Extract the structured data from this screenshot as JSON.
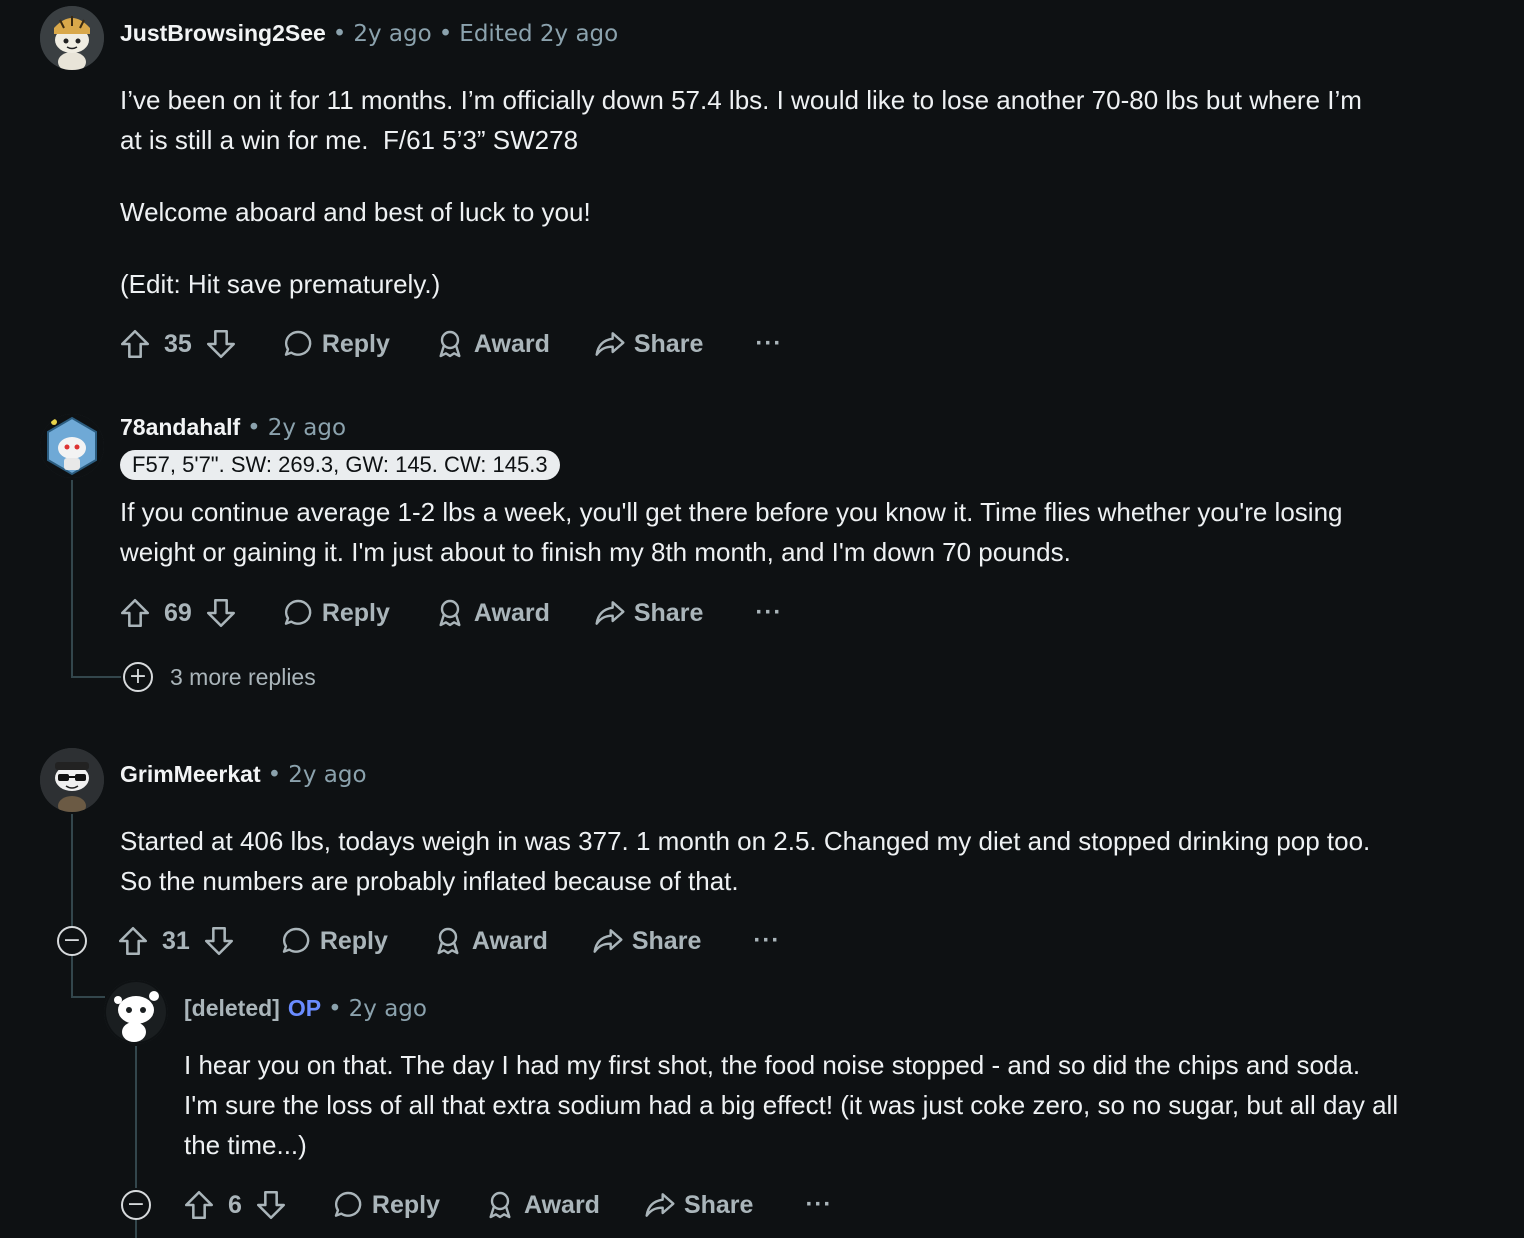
{
  "comments": [
    {
      "username": "JustBrowsing2See",
      "time": "2y ago",
      "edited": "Edited 2y ago",
      "paragraphs": [
        "I’ve been on it for 11 months. I’m officially down 57.4 lbs. I would like to lose another 70-80 lbs but where I’m\nat is still a win for me.  F/61 5’3” SW278",
        "Welcome aboard and best of luck to you!",
        "(Edit: Hit save prematurely.)"
      ],
      "votes": "35",
      "avatar_icon": "tiger-hat-snoo-avatar-icon"
    },
    {
      "username": "78andahalf",
      "time": "2y ago",
      "flair": "F57, 5'7\". SW: 269.3, GW: 145. CW: 145.3",
      "paragraphs": [
        "If you continue average 1-2 lbs a week, you'll get there before you know it. Time flies whether you're losing\nweight or gaining it. I'm just about to finish my 8th month, and I'm down 70 pounds."
      ],
      "votes": "69",
      "more_replies": "3 more replies",
      "avatar_icon": "space-snoo-avatar-icon"
    },
    {
      "username": "GrimMeerkat",
      "time": "2y ago",
      "paragraphs": [
        "Started at 406 lbs, todays weigh in was 377. 1 month on 2.5. Changed my diet and stopped drinking pop too.\nSo the numbers are probably inflated because of that."
      ],
      "votes": "31",
      "avatar_icon": "sunglasses-snoo-avatar-icon"
    },
    {
      "username": "[deleted]",
      "op": "OP",
      "time": "2y ago",
      "paragraphs": [
        "I hear you on that. The day I had my first shot, the food noise stopped - and so did the chips and soda.\nI'm sure the loss of all that extra sodium had a big effect! (it was just coke zero, so no sugar, but all day all\nthe time...)"
      ],
      "votes": "6",
      "avatar_icon": "deleted-snoo-avatar-icon"
    }
  ],
  "labels": {
    "reply": "Reply",
    "award": "Award",
    "share": "Share",
    "more": "···",
    "dot": "•"
  },
  "colors": {
    "background": "#0e1113",
    "op": "#6a8cff",
    "flair_bg": "#eaedef"
  }
}
